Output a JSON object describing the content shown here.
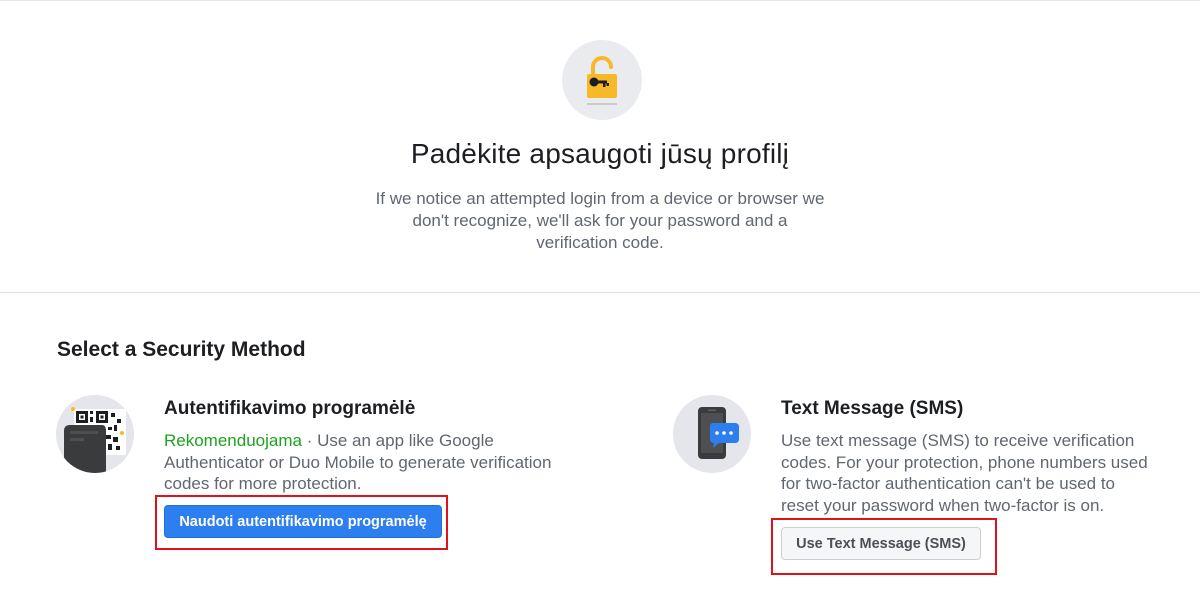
{
  "hero": {
    "icon": "lock-key-icon",
    "title": "Padėkite apsaugoti jūsų profilį",
    "description": "If we notice an attempted login from a device or browser we don't recognize, we'll ask for your password and a verification code."
  },
  "section": {
    "title": "Select a Security Method"
  },
  "methods": [
    {
      "icon": "qr-code-icon",
      "title": "Autentifikavimo programėlė",
      "recommended": "Rekomenduojama",
      "separator": " · ",
      "description": "Use an app like Google Authenticator or Duo Mobile to generate verification codes for more protection.",
      "button_label": "Naudoti autentifikavimo programėlę"
    },
    {
      "icon": "phone-message-icon",
      "title": "Text Message (SMS)",
      "description": "Use text message (SMS) to receive verification codes. For your protection, phone numbers used for two-factor authentication can't be used to reset your password when two-factor is on.",
      "button_label": "Use Text Message (SMS)"
    }
  ],
  "colors": {
    "primary_button": "#2d7ff0",
    "recommended_text": "#1ea31e",
    "highlight_box": "#e0121b",
    "lock_icon": "#f7b928"
  }
}
